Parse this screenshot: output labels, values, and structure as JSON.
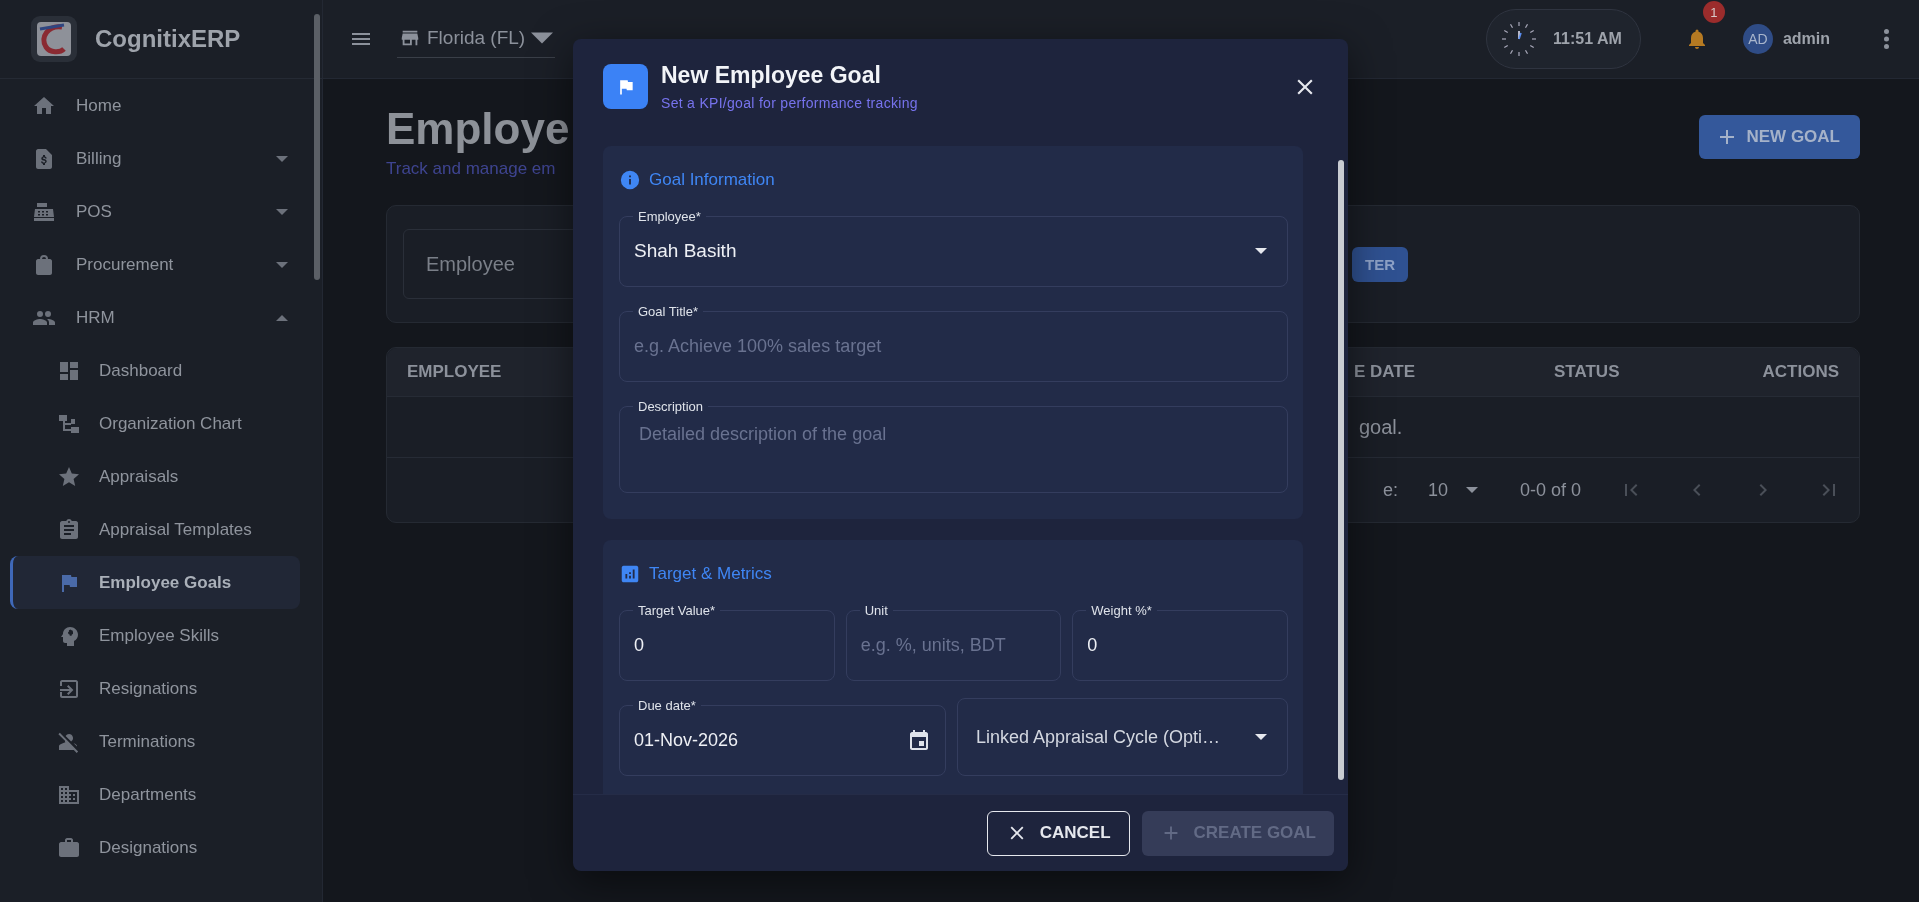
{
  "app": {
    "name": "CognitixERP"
  },
  "sidebar": {
    "items": [
      {
        "label": "Home",
        "kind": "link",
        "selected": false
      },
      {
        "label": "Billing",
        "kind": "group",
        "expanded": false,
        "selected": false
      },
      {
        "label": "POS",
        "kind": "group",
        "expanded": false,
        "selected": false
      },
      {
        "label": "Procurement",
        "kind": "group",
        "expanded": false,
        "selected": false
      },
      {
        "label": "HRM",
        "kind": "group",
        "expanded": true,
        "selected": false,
        "children": [
          {
            "label": "Dashboard",
            "selected": false
          },
          {
            "label": "Organization Chart",
            "selected": false
          },
          {
            "label": "Appraisals",
            "selected": false
          },
          {
            "label": "Appraisal Templates",
            "selected": false
          },
          {
            "label": "Employee Goals",
            "selected": true
          },
          {
            "label": "Employee Skills",
            "selected": false
          },
          {
            "label": "Resignations",
            "selected": false
          },
          {
            "label": "Terminations",
            "selected": false
          },
          {
            "label": "Departments",
            "selected": false
          },
          {
            "label": "Designations",
            "selected": false
          }
        ]
      }
    ]
  },
  "topbar": {
    "location": "Florida (FL)",
    "time": "11:51 AM",
    "notification_count": "1",
    "avatar_initials": "AD",
    "user": "admin"
  },
  "page": {
    "title": "Employe",
    "subtitle": "Track and manage em",
    "new_button": "NEW GOAL",
    "filter": {
      "field_placeholder": "Employee",
      "button": "TER"
    },
    "table": {
      "columns": [
        "EMPLOYEE",
        "E DATE",
        "STATUS",
        "ACTIONS"
      ],
      "empty_message": "goal.",
      "pagination": {
        "rows_label": "e:",
        "rows_per_page": "10",
        "range": "0-0 of 0",
        "nav_disabled": true
      }
    }
  },
  "dialog": {
    "title": "New Employee Goal",
    "subtitle": "Set a KPI/goal for performance tracking",
    "sections": [
      {
        "title": "Goal Information",
        "rows": [
          [
            {
              "kind": "select",
              "label": "Employee*",
              "value": "Shah Basith"
            }
          ],
          [
            {
              "kind": "text",
              "label": "Goal Title*",
              "placeholder": "e.g. Achieve 100% sales target"
            }
          ],
          [
            {
              "kind": "textarea",
              "label": "Description",
              "placeholder": "Detailed description of the goal"
            }
          ]
        ]
      },
      {
        "title": "Target & Metrics",
        "rows": [
          [
            {
              "kind": "text",
              "label": "Target Value*",
              "value": "0"
            },
            {
              "kind": "text",
              "label": "Unit",
              "placeholder": "e.g. %, units, BDT"
            },
            {
              "kind": "text",
              "label": "Weight %*",
              "value": "0"
            }
          ],
          [
            {
              "kind": "date",
              "label": "Due date*",
              "value": "01-Nov-2026"
            },
            {
              "kind": "select",
              "label": "Linked Appraisal Cycle (Opti…"
            }
          ]
        ]
      }
    ],
    "buttons": [
      {
        "label": "CANCEL",
        "kind": "cancel",
        "disabled": false
      },
      {
        "label": "CREATE GOAL",
        "kind": "create",
        "disabled": true
      }
    ]
  }
}
